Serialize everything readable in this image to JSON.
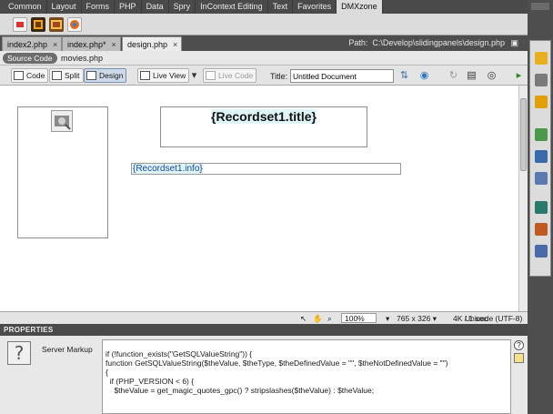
{
  "insert_panel": {
    "tabs": [
      "Common",
      "Layout",
      "Forms",
      "PHP",
      "Data",
      "Spry",
      "InContext Editing",
      "Text",
      "Favorites",
      "DMXzone"
    ],
    "active_tab": "DMXzone",
    "icons": [
      "dmx-icon-1",
      "dmx-icon-2",
      "dmx-icon-3",
      "dmx-icon-4"
    ]
  },
  "document_tabs": [
    {
      "label": "index2.php",
      "close": "×"
    },
    {
      "label": "index.php*",
      "close": "×"
    },
    {
      "label": "design.php",
      "close": "×"
    }
  ],
  "path_label": "Path:",
  "path_value": "C:\\Develop\\slidingpanels\\design.php",
  "related_files": {
    "source_code": "Source Code",
    "file": "movies.php"
  },
  "doc_toolbar": {
    "code": "Code",
    "split": "Split",
    "design": "Design",
    "live_view": "Live View",
    "live_code": "Live Code",
    "title_label": "Title:",
    "title_value": "Untitled Document"
  },
  "canvas": {
    "title_binding": "{Recordset1.title}",
    "info_binding": "{Recordset1.info}"
  },
  "status_bar": {
    "zoom": "100%",
    "dimensions": "765 x 326",
    "download": "4K / 1 sec",
    "encoding": "Unicode (UTF-8)"
  },
  "properties": {
    "header": "PROPERTIES",
    "label": "Server Markup",
    "help": "?",
    "code_lines": [
      "if (!function_exists(\"GetSQLValueString\")) {",
      "function GetSQLValueString($theValue, $theType, $theDefinedValue = \"\", $theNotDefinedValue = \"\")",
      "{",
      "  if (PHP_VERSION < 6) {",
      "    $theValue = get_magic_quotes_gpc() ? stripslashes($theValue) : $theValue;"
    ]
  },
  "colors": {
    "chrome_dark": "#4a4a4a",
    "panel_light": "#e4e4e4",
    "dynamic_text_bg": "#dff4f6"
  }
}
